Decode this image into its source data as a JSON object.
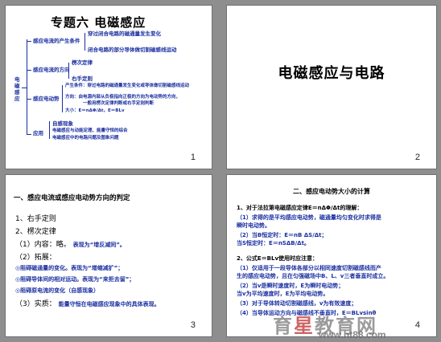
{
  "slides": [
    {
      "number": "1",
      "title": "专题六   电磁感应",
      "tree": {
        "root": "电磁感应",
        "n1": "感应电流的产生条件",
        "n1a": "穿过闭合电路的磁通量发生变化",
        "n1b": "闭合电路的部分导体做切割磁感线运动",
        "n2": "感应电流的方向",
        "n2a": "楞次定律",
        "n2b": "右手定则",
        "n3": "感应电动势",
        "n3a": "产生条件：穿过电路的磁通量发生变化或导体做切割磁感线运动",
        "n3b": "方向：由电源内部从负极指向正极的方向为电动势的方向，",
        "n3b2": "一般用楞次定律判断或右手定则判断",
        "n3c": "大小：E＝nΔΦ/Δt，E＝BLv",
        "n4": "应用",
        "n4a": "自感现象",
        "n4b": "电磁感应与动能定理、能量守恒的综合",
        "n4c": "电磁感应中的电路问题及图象问题"
      }
    },
    {
      "number": "2",
      "title": "电磁感应与电路"
    },
    {
      "number": "3",
      "heading": "一、感应电流或感应电动势方向的判定",
      "lines": [
        "1、右手定则",
        "2、楞次定律",
        "（1）内容：略。",
        "（2）拓展：",
        "（3）实质："
      ],
      "blue": {
        "l3": "表现为“增反减同”。",
        "l5": "◎阻碍磁通量的变化。表现为“增缩减扩”；",
        "l6": "◎阻碍导体间的相对运动。表现为“来拒去留”；",
        "l7": "◎阻碍原电流的变化（自感现象）",
        "l8": "能量守恒在电磁感应现象中的具体表现。"
      }
    },
    {
      "number": "4",
      "heading": "二、感应电动势大小的计算",
      "lines": [
        "1、对于法拉第电磁感应定律E＝nΔΦ/Δt的理解：",
        "（1）求得的是平均感应电动势，磁通量均匀变化时求得是",
        "     瞬时电动势。",
        "（2）当B恒定时：E＝nB ΔS/Δt；",
        "     当S恒定时：E＝nSΔB/Δt。",
        "2、公式E＝BLv使用时应注意：",
        "（1）仅适用于一段导体各部分以相同速度切割磁感线而产",
        "     生的感应电动势，且在匀强磁场中B、L、v三者垂直时成立。",
        "（2）当v是瞬时速度时，E为瞬时电动势；",
        "     当v为平均速度时，E为平均电动势。",
        "（3）对于导体转动切割磁感线，v为有效速度；",
        "（4）当导体运动方向与磁感线不垂直时，E＝BLvsinθ"
      ]
    }
  ],
  "watermark": {
    "text_left": "育",
    "text_mid": "星",
    "text_right": "教育网",
    "url": "www.ht88.com"
  },
  "colors": {
    "background": "#8e8e8e",
    "slide": "#ffffff",
    "tree_blue": "#1a2fa0",
    "watermark_red": "#c03030"
  }
}
